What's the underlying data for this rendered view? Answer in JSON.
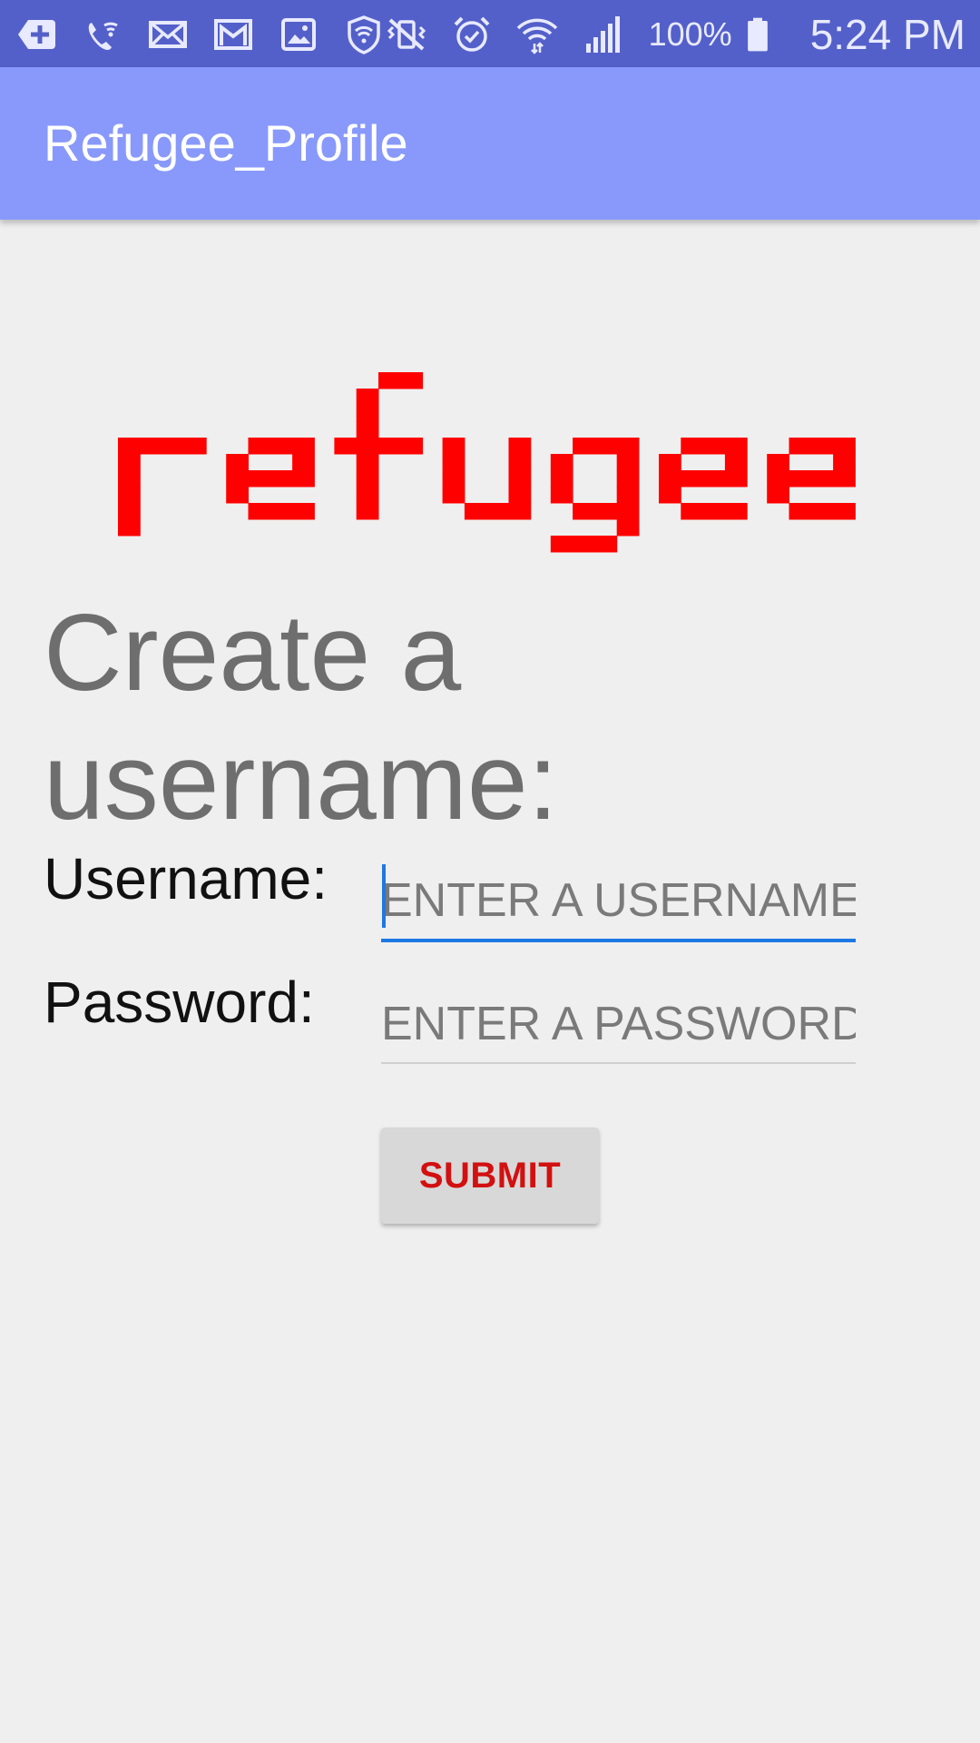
{
  "status_bar": {
    "left_icons": [
      "plus-box-icon",
      "wifi-call-icon",
      "mail-icon",
      "gmail-icon",
      "gallery-icon",
      "shield-wifi-icon"
    ],
    "right_icons": [
      "vibrate-mute-icon",
      "alarm-icon",
      "wifi-icon",
      "cell-signal-icon"
    ],
    "battery_percent": "100%",
    "time": "5:24 PM"
  },
  "app_bar": {
    "title": "Refugee_Profile",
    "color": "#8899fb"
  },
  "logo": {
    "text": "refugee",
    "color": "#ff0000"
  },
  "heading": "Create a username:",
  "form": {
    "username_label": "Username:",
    "username_placeholder": "ENTER A USERNAME:",
    "username_value": "",
    "password_label": "Password:",
    "password_placeholder": "ENTER A PASSWORD:",
    "password_value": "",
    "submit_label": "SUBMIT"
  },
  "colors": {
    "status_bar": "#5460c9",
    "accent": "#1e78e4",
    "button_text": "#d21010"
  }
}
